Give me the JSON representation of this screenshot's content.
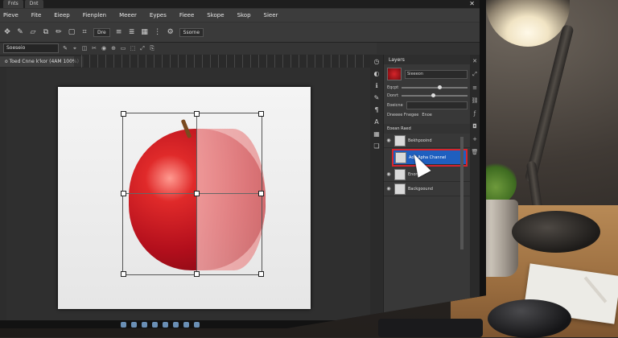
{
  "window": {
    "tabs": [
      "Fnts",
      "Dnt"
    ],
    "close_icon": "close-icon"
  },
  "menu": [
    "Pieve",
    "Fite",
    "Eieep",
    "Fienplen",
    "Meeer",
    "Eypes",
    "Fieee",
    "Skope",
    "Skop",
    "Sieer"
  ],
  "options": {
    "blend_select": "Dre",
    "mode_select": "Ssorne",
    "font_select": "Soeseio"
  },
  "document": {
    "tab_label": "o Toed Cnne k'kor (4AM 100%)"
  },
  "layers_panel": {
    "title": "Layers",
    "kind_select": "Sieeeon",
    "opacity_label": "Eqcpt",
    "fill_label": "Donrt",
    "lock_label": "Eoeicne",
    "blend_label": "Dneeee Fnegee",
    "blend_value": "Enoe",
    "group_label": "Eoean Raed",
    "layers": [
      {
        "name": "Bekhpooind",
        "active": false
      },
      {
        "name": "Add Apha Channel",
        "active": true
      },
      {
        "name": "Enonn",
        "active": false
      },
      {
        "name": "Backgoound",
        "active": false
      }
    ],
    "opacity": 0.55,
    "fill": 0.45
  },
  "colors": {
    "accent": "#1f5fbf",
    "highlight": "#d6252e"
  }
}
